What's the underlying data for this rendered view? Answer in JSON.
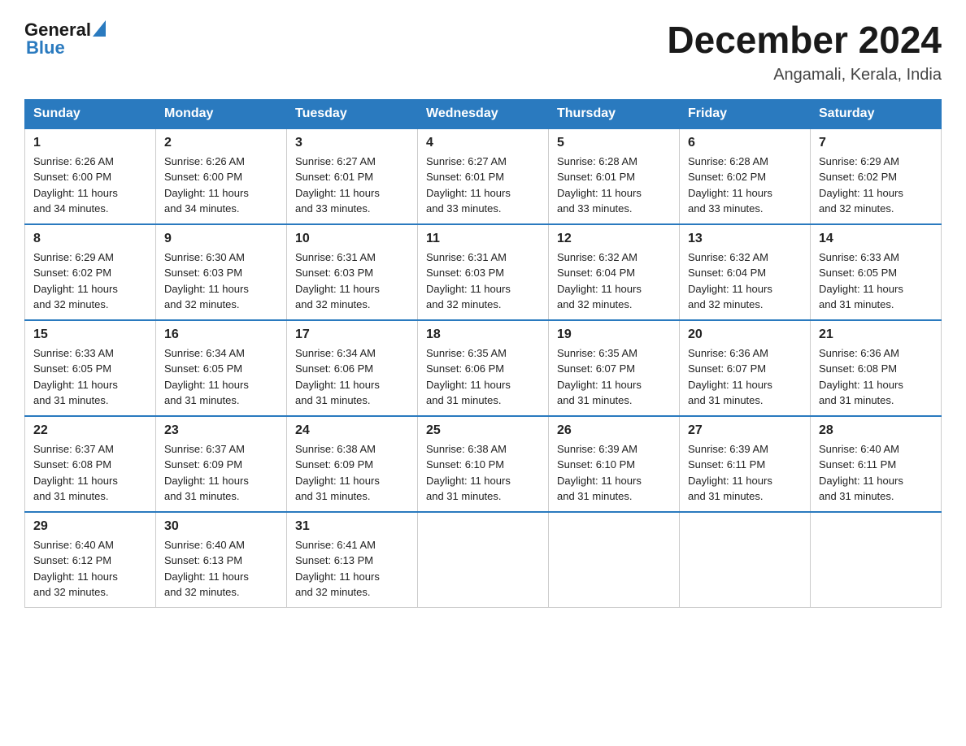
{
  "header": {
    "logo_general": "General",
    "logo_blue": "Blue",
    "title": "December 2024",
    "subtitle": "Angamali, Kerala, India"
  },
  "days_of_week": [
    "Sunday",
    "Monday",
    "Tuesday",
    "Wednesday",
    "Thursday",
    "Friday",
    "Saturday"
  ],
  "weeks": [
    [
      {
        "day": "1",
        "sunrise": "6:26 AM",
        "sunset": "6:00 PM",
        "daylight": "11 hours and 34 minutes."
      },
      {
        "day": "2",
        "sunrise": "6:26 AM",
        "sunset": "6:00 PM",
        "daylight": "11 hours and 34 minutes."
      },
      {
        "day": "3",
        "sunrise": "6:27 AM",
        "sunset": "6:01 PM",
        "daylight": "11 hours and 33 minutes."
      },
      {
        "day": "4",
        "sunrise": "6:27 AM",
        "sunset": "6:01 PM",
        "daylight": "11 hours and 33 minutes."
      },
      {
        "day": "5",
        "sunrise": "6:28 AM",
        "sunset": "6:01 PM",
        "daylight": "11 hours and 33 minutes."
      },
      {
        "day": "6",
        "sunrise": "6:28 AM",
        "sunset": "6:02 PM",
        "daylight": "11 hours and 33 minutes."
      },
      {
        "day": "7",
        "sunrise": "6:29 AM",
        "sunset": "6:02 PM",
        "daylight": "11 hours and 32 minutes."
      }
    ],
    [
      {
        "day": "8",
        "sunrise": "6:29 AM",
        "sunset": "6:02 PM",
        "daylight": "11 hours and 32 minutes."
      },
      {
        "day": "9",
        "sunrise": "6:30 AM",
        "sunset": "6:03 PM",
        "daylight": "11 hours and 32 minutes."
      },
      {
        "day": "10",
        "sunrise": "6:31 AM",
        "sunset": "6:03 PM",
        "daylight": "11 hours and 32 minutes."
      },
      {
        "day": "11",
        "sunrise": "6:31 AM",
        "sunset": "6:03 PM",
        "daylight": "11 hours and 32 minutes."
      },
      {
        "day": "12",
        "sunrise": "6:32 AM",
        "sunset": "6:04 PM",
        "daylight": "11 hours and 32 minutes."
      },
      {
        "day": "13",
        "sunrise": "6:32 AM",
        "sunset": "6:04 PM",
        "daylight": "11 hours and 32 minutes."
      },
      {
        "day": "14",
        "sunrise": "6:33 AM",
        "sunset": "6:05 PM",
        "daylight": "11 hours and 31 minutes."
      }
    ],
    [
      {
        "day": "15",
        "sunrise": "6:33 AM",
        "sunset": "6:05 PM",
        "daylight": "11 hours and 31 minutes."
      },
      {
        "day": "16",
        "sunrise": "6:34 AM",
        "sunset": "6:05 PM",
        "daylight": "11 hours and 31 minutes."
      },
      {
        "day": "17",
        "sunrise": "6:34 AM",
        "sunset": "6:06 PM",
        "daylight": "11 hours and 31 minutes."
      },
      {
        "day": "18",
        "sunrise": "6:35 AM",
        "sunset": "6:06 PM",
        "daylight": "11 hours and 31 minutes."
      },
      {
        "day": "19",
        "sunrise": "6:35 AM",
        "sunset": "6:07 PM",
        "daylight": "11 hours and 31 minutes."
      },
      {
        "day": "20",
        "sunrise": "6:36 AM",
        "sunset": "6:07 PM",
        "daylight": "11 hours and 31 minutes."
      },
      {
        "day": "21",
        "sunrise": "6:36 AM",
        "sunset": "6:08 PM",
        "daylight": "11 hours and 31 minutes."
      }
    ],
    [
      {
        "day": "22",
        "sunrise": "6:37 AM",
        "sunset": "6:08 PM",
        "daylight": "11 hours and 31 minutes."
      },
      {
        "day": "23",
        "sunrise": "6:37 AM",
        "sunset": "6:09 PM",
        "daylight": "11 hours and 31 minutes."
      },
      {
        "day": "24",
        "sunrise": "6:38 AM",
        "sunset": "6:09 PM",
        "daylight": "11 hours and 31 minutes."
      },
      {
        "day": "25",
        "sunrise": "6:38 AM",
        "sunset": "6:10 PM",
        "daylight": "11 hours and 31 minutes."
      },
      {
        "day": "26",
        "sunrise": "6:39 AM",
        "sunset": "6:10 PM",
        "daylight": "11 hours and 31 minutes."
      },
      {
        "day": "27",
        "sunrise": "6:39 AM",
        "sunset": "6:11 PM",
        "daylight": "11 hours and 31 minutes."
      },
      {
        "day": "28",
        "sunrise": "6:40 AM",
        "sunset": "6:11 PM",
        "daylight": "11 hours and 31 minutes."
      }
    ],
    [
      {
        "day": "29",
        "sunrise": "6:40 AM",
        "sunset": "6:12 PM",
        "daylight": "11 hours and 32 minutes."
      },
      {
        "day": "30",
        "sunrise": "6:40 AM",
        "sunset": "6:13 PM",
        "daylight": "11 hours and 32 minutes."
      },
      {
        "day": "31",
        "sunrise": "6:41 AM",
        "sunset": "6:13 PM",
        "daylight": "11 hours and 32 minutes."
      },
      null,
      null,
      null,
      null
    ]
  ],
  "labels": {
    "sunrise": "Sunrise:",
    "sunset": "Sunset:",
    "daylight": "Daylight:"
  }
}
